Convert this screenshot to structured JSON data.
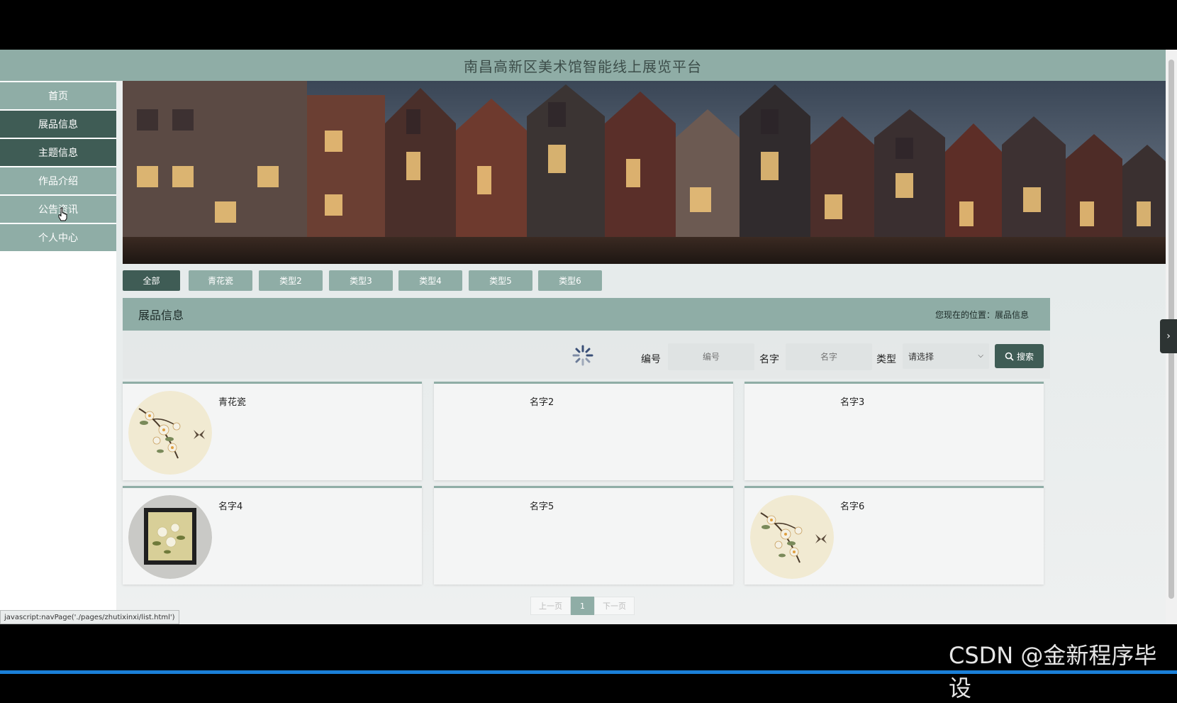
{
  "header": {
    "title": "南昌高新区美术馆智能线上展览平台"
  },
  "sidebar": {
    "items": [
      {
        "label": "首页"
      },
      {
        "label": "展品信息"
      },
      {
        "label": "主题信息"
      },
      {
        "label": "作品介绍"
      },
      {
        "label": "公告资讯"
      },
      {
        "label": "个人中心"
      }
    ]
  },
  "tabs": [
    "全部",
    "青花瓷",
    "类型2",
    "类型3",
    "类型4",
    "类型5",
    "类型6"
  ],
  "section": {
    "title": "展品信息",
    "breadcrumb": "您现在的位置：展品信息"
  },
  "search": {
    "id_label": "编号",
    "id_placeholder": "编号",
    "name_label": "名字",
    "name_placeholder": "名字",
    "type_label": "类型",
    "type_selected": "请选择",
    "button_label": "搜索"
  },
  "cards": [
    {
      "name": "青花瓷",
      "image": "flower-branch-plate"
    },
    {
      "name": "名字2",
      "image": ""
    },
    {
      "name": "名字3",
      "image": ""
    },
    {
      "name": "名字4",
      "image": "framed-flower-painting"
    },
    {
      "name": "名字5",
      "image": ""
    },
    {
      "name": "名字6",
      "image": "flower-branch-plate"
    }
  ],
  "pagination": {
    "prev": "上一页",
    "current": "1",
    "next": "下一页"
  },
  "statusbar": {
    "text": "javascript:navPage('./pages/zhutixinxi/list.html')"
  },
  "watermark": {
    "text": "CSDN @金新程序毕设"
  },
  "colors": {
    "primary": "#8fada6",
    "primary_dark": "#3f5c55"
  }
}
